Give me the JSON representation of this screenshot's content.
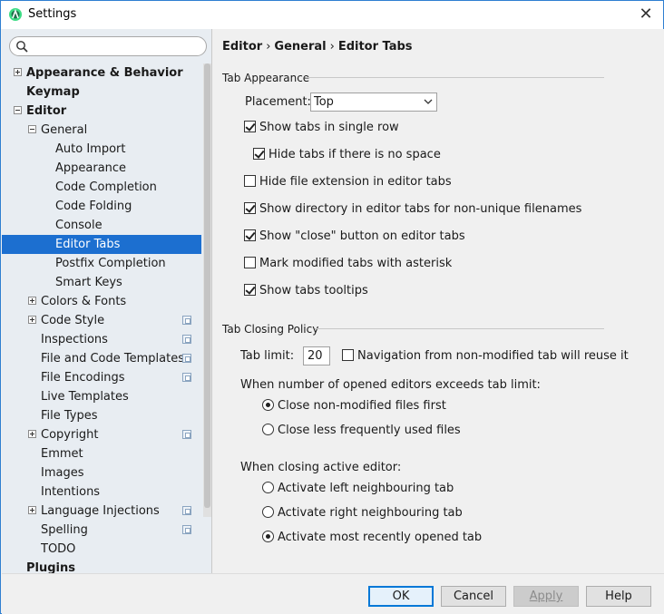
{
  "window": {
    "title": "Settings"
  },
  "search": {
    "placeholder": ""
  },
  "sidebar": {
    "items": [
      {
        "label": "Appearance & Behavior",
        "level": 0,
        "expander": "plus",
        "bold": true
      },
      {
        "label": "Keymap",
        "level": 0,
        "expander": "",
        "bold": true
      },
      {
        "label": "Editor",
        "level": 0,
        "expander": "minus",
        "bold": true
      },
      {
        "label": "General",
        "level": 1,
        "expander": "minus"
      },
      {
        "label": "Auto Import",
        "level": 2
      },
      {
        "label": "Appearance",
        "level": 2
      },
      {
        "label": "Code Completion",
        "level": 2
      },
      {
        "label": "Code Folding",
        "level": 2
      },
      {
        "label": "Console",
        "level": 2
      },
      {
        "label": "Editor Tabs",
        "level": 2,
        "selected": true
      },
      {
        "label": "Postfix Completion",
        "level": 2
      },
      {
        "label": "Smart Keys",
        "level": 2
      },
      {
        "label": "Colors & Fonts",
        "level": 1,
        "expander": "plus"
      },
      {
        "label": "Code Style",
        "level": 1,
        "expander": "plus",
        "project": true
      },
      {
        "label": "Inspections",
        "level": 1,
        "project": true
      },
      {
        "label": "File and Code Templates",
        "level": 1,
        "project": true
      },
      {
        "label": "File Encodings",
        "level": 1,
        "project": true
      },
      {
        "label": "Live Templates",
        "level": 1
      },
      {
        "label": "File Types",
        "level": 1
      },
      {
        "label": "Copyright",
        "level": 1,
        "expander": "plus",
        "project": true
      },
      {
        "label": "Emmet",
        "level": 1
      },
      {
        "label": "Images",
        "level": 1
      },
      {
        "label": "Intentions",
        "level": 1
      },
      {
        "label": "Language Injections",
        "level": 1,
        "expander": "plus",
        "project": true
      },
      {
        "label": "Spelling",
        "level": 1,
        "project": true
      },
      {
        "label": "TODO",
        "level": 1
      },
      {
        "label": "Plugins",
        "level": 0,
        "bold": true
      }
    ]
  },
  "breadcrumb": {
    "part1": "Editor",
    "part2": "General",
    "part3": "Editor Tabs",
    "sep": "›"
  },
  "tab_appearance": {
    "title": "Tab Appearance",
    "placement_label": "Placement:",
    "placement_value": "Top",
    "show_tabs_single_row": {
      "label": "Show tabs in single row",
      "checked": true
    },
    "hide_tabs_no_space": {
      "label": "Hide tabs if there is no space",
      "checked": true
    },
    "hide_file_ext": {
      "label": "Hide file extension in editor tabs",
      "checked": false
    },
    "show_directory": {
      "label": "Show directory in editor tabs for non-unique filenames",
      "checked": true
    },
    "show_close_button": {
      "label": "Show \"close\" button on editor tabs",
      "checked": true
    },
    "mark_modified": {
      "label": "Mark modified tabs with asterisk",
      "checked": false
    },
    "show_tooltips": {
      "label": "Show tabs tooltips",
      "checked": true
    }
  },
  "tab_closing": {
    "title": "Tab Closing Policy",
    "tab_limit_label": "Tab limit:",
    "tab_limit_value": "20",
    "nav_reuse": {
      "label": "Navigation from non-modified tab will reuse it",
      "checked": false
    },
    "exceeds_label": "When number of opened editors exceeds tab limit:",
    "close_non_modified": {
      "label": "Close non-modified files first",
      "checked": true
    },
    "close_less_frequent": {
      "label": "Close less frequently used files",
      "checked": false
    },
    "closing_active_label": "When closing active editor:",
    "activate_left": {
      "label": "Activate left neighbouring tab",
      "checked": false
    },
    "activate_right": {
      "label": "Activate right neighbouring tab",
      "checked": false
    },
    "activate_recent": {
      "label": "Activate most recently opened tab",
      "checked": true
    }
  },
  "footer": {
    "ok": "OK",
    "cancel": "Cancel",
    "apply": "Apply",
    "help": "Help"
  },
  "colors": {
    "selection": "#1c6fd0",
    "accent": "#0078d7"
  }
}
